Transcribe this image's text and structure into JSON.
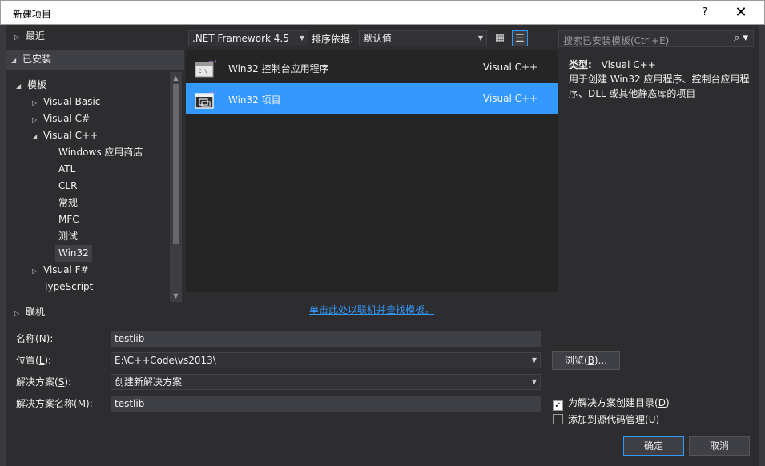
{
  "window": {
    "title": "新建项目",
    "help_label": "?",
    "close_label": "✕"
  },
  "tree": {
    "recent": "最近",
    "installed": "已安装",
    "templates": "模板",
    "visual_basic": "Visual Basic",
    "visual_csharp": "Visual C#",
    "visual_cpp": "Visual C++",
    "cpp_children": [
      "Windows 应用商店",
      "ATL",
      "CLR",
      "常规",
      "MFC",
      "测试",
      "Win32"
    ],
    "visual_fsharp": "Visual F#",
    "typescript": "TypeScript",
    "online": "联机"
  },
  "toolbar": {
    "framework": ".NET Framework 4.5",
    "sort_label": "排序依据:",
    "sort_value": "默认值",
    "search_placeholder": "搜索已安装模板(Ctrl+E)"
  },
  "templates": [
    {
      "name": "Win32 控制台应用程序",
      "lang": "Visual C++"
    },
    {
      "name": "Win32 项目",
      "lang": "Visual C++"
    }
  ],
  "details": {
    "type_label": "类型:",
    "type_value": "Visual C++",
    "description": "用于创建 Win32 应用程序、控制台应用程序、DLL 或其他静态库的项目"
  },
  "online_link": "单击此处以联机并查找模板。",
  "form": {
    "name_label_pre": "名称(",
    "name_key": "N",
    "name_label_post": "):",
    "name_value": "testlib",
    "location_label_pre": "位置(",
    "location_key": "L",
    "location_label_post": "):",
    "location_value": "E:\\C++Code\\vs2013\\",
    "solution_label_pre": "解决方案(",
    "solution_key": "S",
    "solution_label_post": "):",
    "solution_value": "创建新解决方案",
    "solution_name_label_pre": "解决方案名称(",
    "solution_name_key": "M",
    "solution_name_label_post": "):",
    "solution_name_value": "testlib",
    "browse_pre": "浏览(",
    "browse_key": "B",
    "browse_post": ")...",
    "create_dir_pre": "为解决方案创建目录(",
    "create_dir_key": "D",
    "create_dir_post": ")",
    "create_dir_checked": true,
    "add_source_pre": "添加到源代码管理(",
    "add_source_key": "U",
    "add_source_post": ")",
    "add_source_checked": false,
    "ok_label": "确定",
    "cancel_label": "取消"
  },
  "colors": {
    "accent": "#3399ff",
    "background": "#2d2d30",
    "list_background": "#252526"
  }
}
